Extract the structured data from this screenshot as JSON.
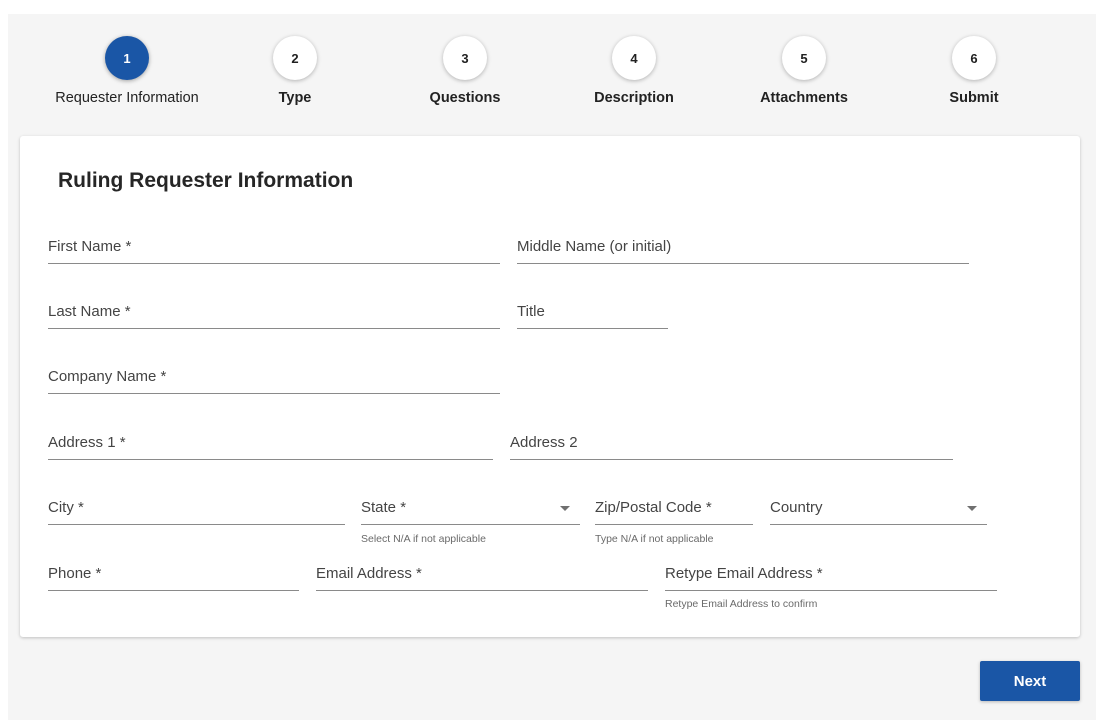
{
  "stepper": {
    "steps": [
      {
        "number": "1",
        "label": "Requester Information",
        "active": true
      },
      {
        "number": "2",
        "label": "Type"
      },
      {
        "number": "3",
        "label": "Questions"
      },
      {
        "number": "4",
        "label": "Description"
      },
      {
        "number": "5",
        "label": "Attachments"
      },
      {
        "number": "6",
        "label": "Submit"
      }
    ]
  },
  "form": {
    "title": "Ruling Requester Information",
    "fields": {
      "first_name": {
        "label": "First Name *",
        "value": ""
      },
      "middle_name": {
        "label": "Middle Name (or initial)",
        "value": ""
      },
      "last_name": {
        "label": "Last Name *",
        "value": ""
      },
      "title": {
        "label": "Title",
        "value": ""
      },
      "company_name": {
        "label": "Company Name *",
        "value": ""
      },
      "address1": {
        "label": "Address 1 *",
        "value": ""
      },
      "address2": {
        "label": "Address 2",
        "value": ""
      },
      "city": {
        "label": "City *",
        "value": ""
      },
      "state": {
        "label": "State *",
        "hint": "Select N/A if not applicable",
        "value": ""
      },
      "zip": {
        "label": "Zip/Postal Code  *",
        "hint": "Type N/A if not applicable",
        "value": ""
      },
      "country": {
        "label": "Country",
        "value": ""
      },
      "phone": {
        "label": "Phone *",
        "value": ""
      },
      "email": {
        "label": "Email Address *",
        "value": ""
      },
      "retype_email": {
        "label": "Retype Email Address *",
        "hint": "Retype Email Address to confirm",
        "value": ""
      }
    }
  },
  "actions": {
    "next_label": "Next"
  },
  "colors": {
    "primary": "#1a56a6",
    "background": "#f5f5f5",
    "card": "#ffffff"
  }
}
